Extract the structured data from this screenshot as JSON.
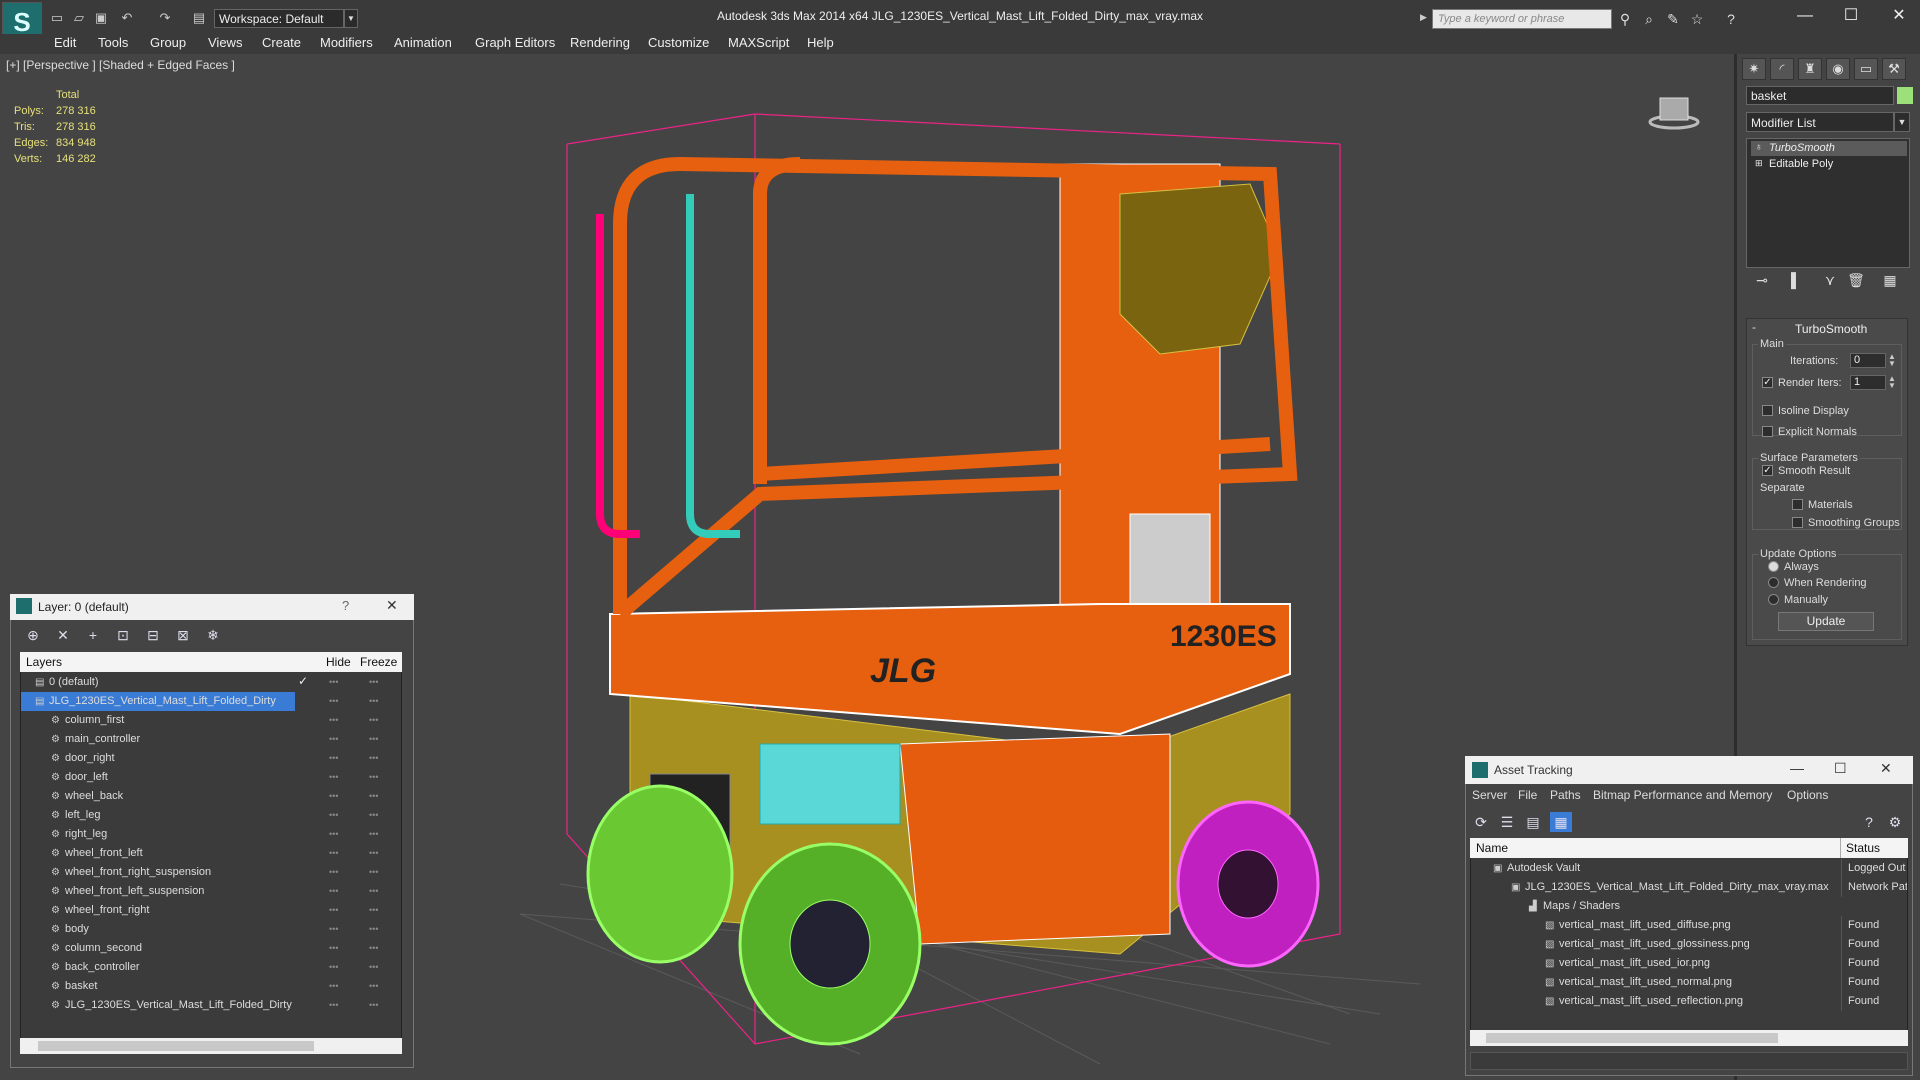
{
  "app": {
    "title": "Autodesk 3ds Max  2014 x64     JLG_1230ES_Vertical_Mast_Lift_Folded_Dirty_max_vray.max",
    "workspace": "Workspace: Default",
    "search_placeholder": "Type a keyword or phrase"
  },
  "menu": [
    "Edit",
    "Tools",
    "Group",
    "Views",
    "Create",
    "Modifiers",
    "Animation",
    "Graph Editors",
    "Rendering",
    "Customize",
    "MAXScript",
    "Help"
  ],
  "viewport": {
    "label": "[+] [Perspective ] [Shaded + Edged Faces ]",
    "stats": {
      "header": "Total",
      "rows": [
        {
          "label": "Polys:",
          "value": "278 316"
        },
        {
          "label": "Tris:",
          "value": "278 316"
        },
        {
          "label": "Edges:",
          "value": "834 948"
        },
        {
          "label": "Verts:",
          "value": "146 282"
        }
      ]
    },
    "decals": {
      "brand": "JLG",
      "model": "1230ES"
    }
  },
  "command_panel": {
    "object_name": "basket",
    "object_color": "#9be07a",
    "modifier_list": "Modifier List",
    "stack": [
      "TurboSmooth",
      "Editable Poly"
    ],
    "rollout_title": "TurboSmooth",
    "main_group": "Main",
    "iterations_label": "Iterations:",
    "iterations_value": "0",
    "render_iters_label": "Render Iters:",
    "render_iters_value": "1",
    "isoline": "Isoline Display",
    "explicit_normals": "Explicit Normals",
    "surface_params": "Surface Parameters",
    "smooth_result": "Smooth Result",
    "separate": "Separate",
    "materials": "Materials",
    "smoothing_groups": "Smoothing Groups",
    "update_options": "Update Options",
    "always": "Always",
    "when_rendering": "When Rendering",
    "manually": "Manually",
    "update_btn": "Update"
  },
  "layer_dialog": {
    "title": "Layer: 0 (default)",
    "help": "?",
    "close": "✕",
    "columns": {
      "layers": "Layers",
      "hide": "Hide",
      "freeze": "Freeze"
    },
    "layers": [
      {
        "name": "0 (default)",
        "level": 1
      },
      {
        "name": "JLG_1230ES_Vertical_Mast_Lift_Folded_Dirty",
        "level": 1,
        "selected": true
      },
      {
        "name": "column_first",
        "level": 2
      },
      {
        "name": "main_controller",
        "level": 2
      },
      {
        "name": "door_right",
        "level": 2
      },
      {
        "name": "door_left",
        "level": 2
      },
      {
        "name": "wheel_back",
        "level": 2
      },
      {
        "name": "left_leg",
        "level": 2
      },
      {
        "name": "right_leg",
        "level": 2
      },
      {
        "name": "wheel_front_left",
        "level": 2
      },
      {
        "name": "wheel_front_right_suspension",
        "level": 2
      },
      {
        "name": "wheel_front_left_suspension",
        "level": 2
      },
      {
        "name": "wheel_front_right",
        "level": 2
      },
      {
        "name": "body",
        "level": 2
      },
      {
        "name": "column_second",
        "level": 2
      },
      {
        "name": "back_controller",
        "level": 2
      },
      {
        "name": "basket",
        "level": 2
      },
      {
        "name": "JLG_1230ES_Vertical_Mast_Lift_Folded_Dirty",
        "level": 2
      }
    ]
  },
  "asset_tracking": {
    "title": "Asset Tracking",
    "menu": [
      "Server",
      "File",
      "Paths",
      "Bitmap Performance and Memory",
      "Options"
    ],
    "columns": {
      "name": "Name",
      "status": "Status"
    },
    "rows": [
      {
        "name": "Autodesk Vault",
        "status": "Logged Out",
        "level": 1
      },
      {
        "name": "JLG_1230ES_Vertical_Mast_Lift_Folded_Dirty_max_vray.max",
        "status": "Network Pat",
        "level": 2
      },
      {
        "name": "Maps / Shaders",
        "status": "",
        "level": 3
      },
      {
        "name": "vertical_mast_lift_used_diffuse.png",
        "status": "Found",
        "level": 4
      },
      {
        "name": "vertical_mast_lift_used_glossiness.png",
        "status": "Found",
        "level": 4
      },
      {
        "name": "vertical_mast_lift_used_ior.png",
        "status": "Found",
        "level": 4
      },
      {
        "name": "vertical_mast_lift_used_normal.png",
        "status": "Found",
        "level": 4
      },
      {
        "name": "vertical_mast_lift_used_reflection.png",
        "status": "Found",
        "level": 4
      }
    ]
  }
}
